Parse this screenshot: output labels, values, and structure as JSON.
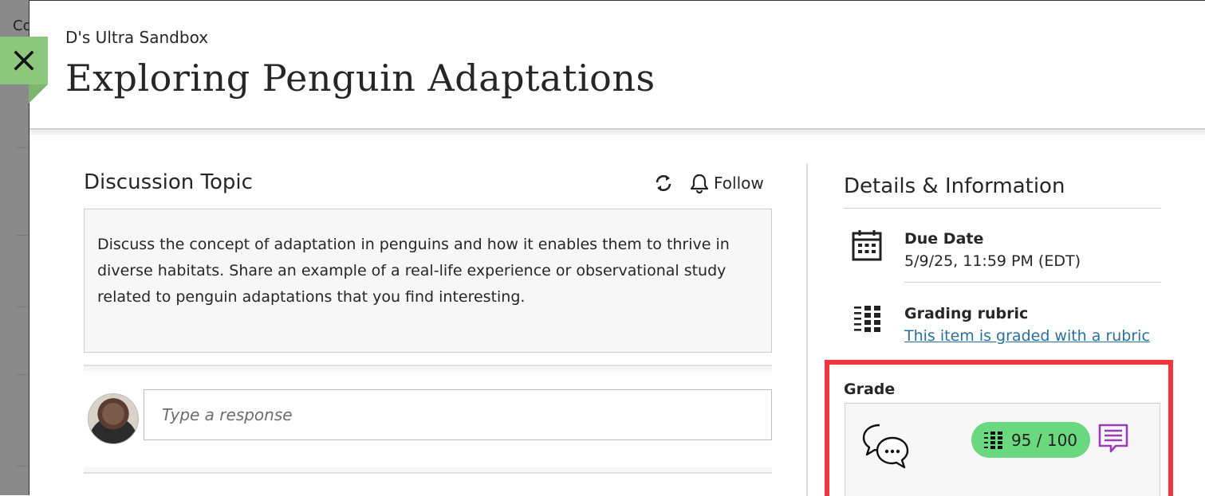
{
  "background": {
    "partial_text": "Co"
  },
  "header": {
    "course_name": "D's Ultra Sandbox",
    "title": "Exploring Penguin Adaptations",
    "close_icon": "close-icon"
  },
  "discussion": {
    "heading": "Discussion Topic",
    "refresh_icon": "refresh-icon",
    "follow_label": "Follow",
    "follow_icon": "bell-icon",
    "prompt": "Discuss the concept of adaptation in penguins and how it enables them to thrive in diverse habitats. Share an example of a real-life experience or observational study related to penguin adaptations that you find interesting.",
    "response_placeholder": "Type a response"
  },
  "details": {
    "heading": "Details & Information",
    "due_date": {
      "label": "Due Date",
      "value": "5/9/25, 11:59 PM (EDT)",
      "icon": "calendar-icon"
    },
    "rubric": {
      "label": "Grading rubric",
      "link": "This item is graded with a rubric",
      "icon": "rubric-icon"
    },
    "grade": {
      "label": "Grade",
      "score": "95 / 100",
      "score_icon": "rubric-grid-icon",
      "feedback_icon": "feedback-icon",
      "discussion_icon": "discussion-bubbles-icon"
    }
  },
  "colors": {
    "close_tab": "#8dc77b",
    "grade_pill": "#6ad87e",
    "highlight": "#f0363c",
    "link": "#2b6f9e",
    "feedback": "#9b3db5"
  }
}
